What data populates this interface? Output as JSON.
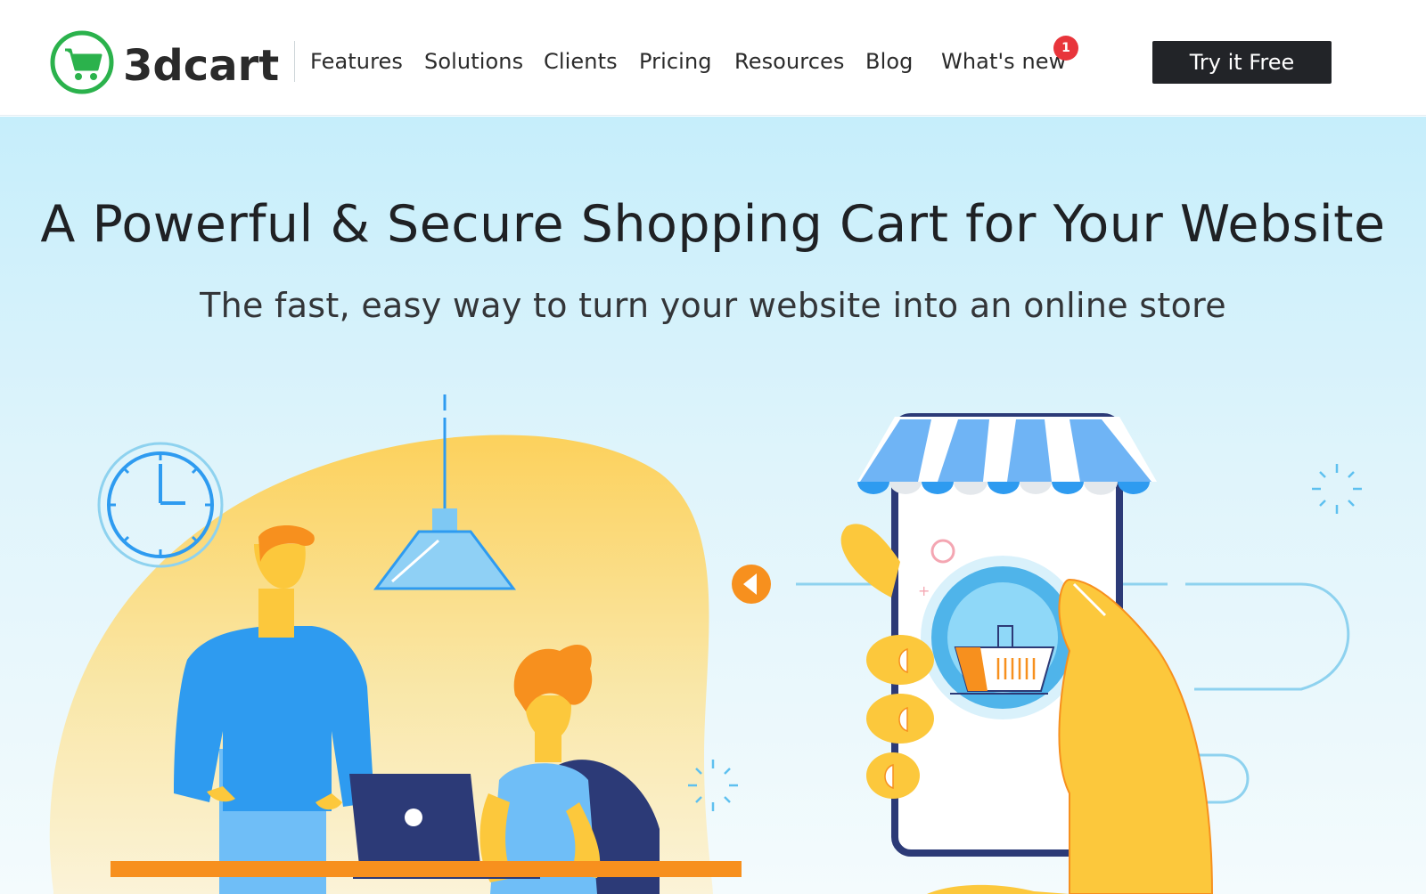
{
  "brand": {
    "name": "3dcart",
    "accent": "#2bb24c"
  },
  "nav": {
    "items": [
      "Features",
      "Solutions",
      "Clients",
      "Pricing",
      "Resources",
      "Blog",
      "What's new"
    ],
    "badge": "1"
  },
  "cta": {
    "label": "Try it Free"
  },
  "hero": {
    "title": "A Powerful & Secure Shopping Cart for Your Website",
    "subtitle": "The fast, easy way to turn your website into an online store"
  },
  "icons": {
    "logo": "shopping-cart-icon",
    "clock": "clock-icon",
    "lamp": "lamp-icon",
    "laptop": "laptop-icon",
    "play": "play-icon",
    "storefront": "storefront-awning-icon",
    "basket": "basket-icon"
  },
  "colors": {
    "hero_bg_top": "#c6eefb",
    "blue": "#2e9bf0",
    "yellow": "#fcc83c",
    "orange": "#f7901e",
    "navy": "#2c3a77"
  }
}
